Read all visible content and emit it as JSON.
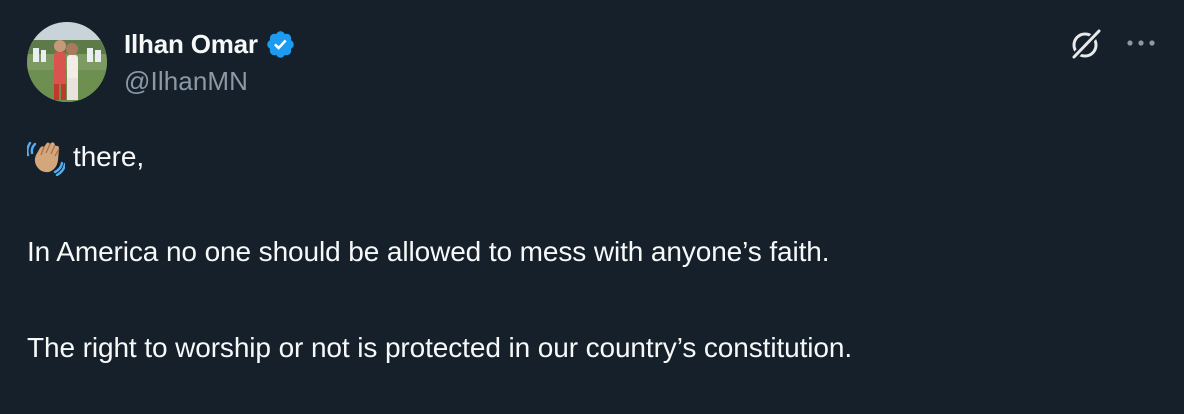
{
  "author": {
    "display_name": "Ilhan Omar",
    "handle": "@IlhanMN",
    "verified": true,
    "avatar": "profile-photo"
  },
  "icons": {
    "verified": "verified-badge-icon",
    "grok": "grok-icon",
    "more": "more-options-icon",
    "emoji": "waving-hand-emoji"
  },
  "tweet": {
    "greeting_emoji": "👋🏼",
    "line1_text": "there,",
    "line2_text": "In America no one should be allowed to mess with anyone’s faith.",
    "line3_text": "The right to worship or not is protected in our country’s constitution."
  },
  "colors": {
    "background": "#15202b",
    "text_primary": "#f7f9f9",
    "text_secondary": "#8b98a5",
    "verified_blue": "#1d9bf0"
  }
}
